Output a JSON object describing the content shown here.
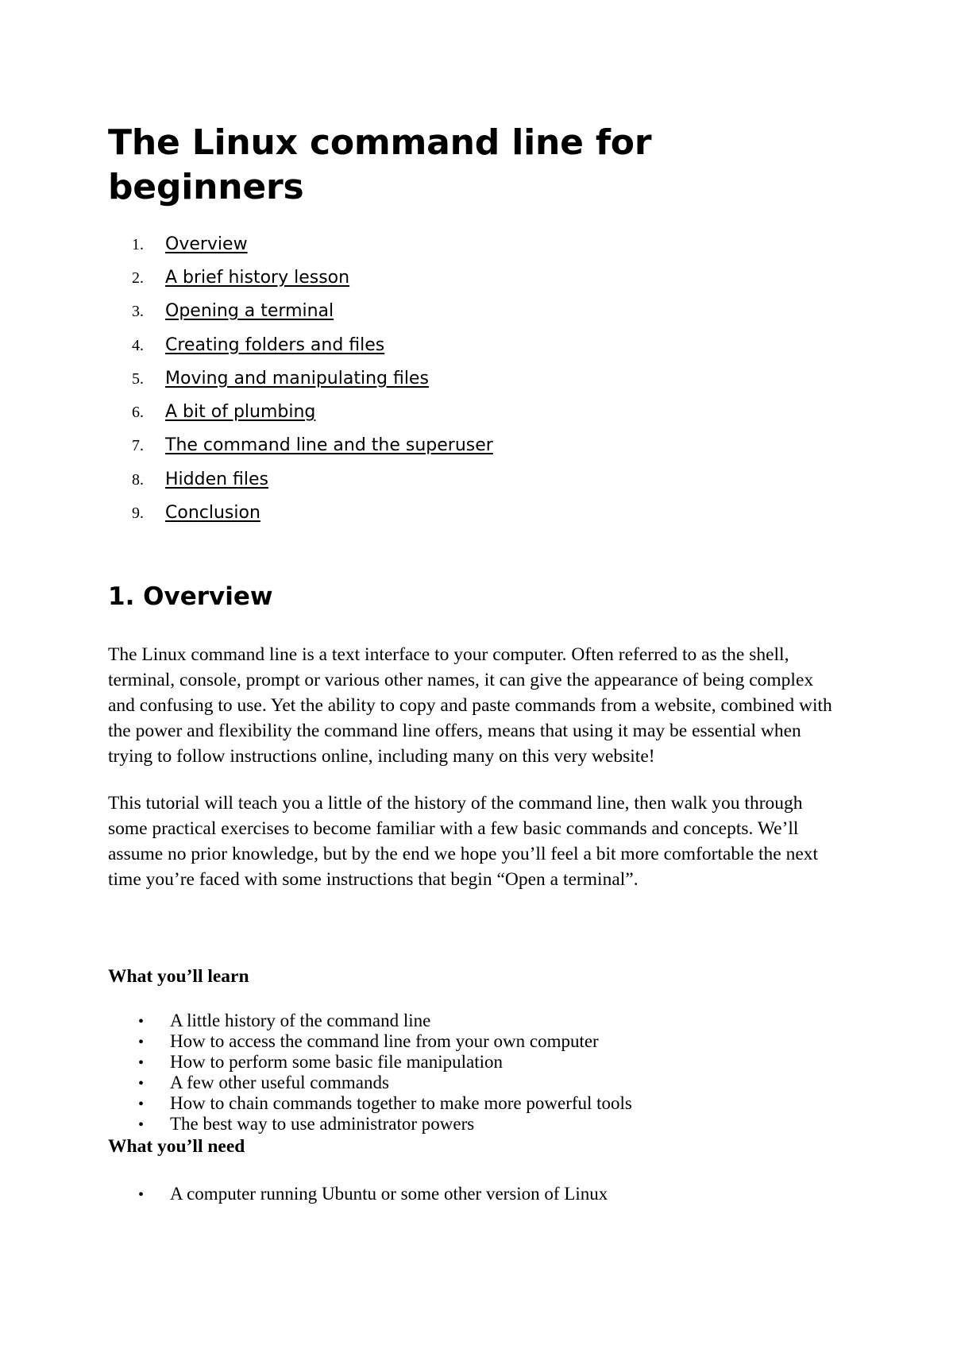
{
  "document": {
    "title": "The Linux command line for beginners",
    "bullet_glyph": "•"
  },
  "toc": {
    "items": [
      {
        "number": "1.",
        "label": "Overview"
      },
      {
        "number": "2.",
        "label": "A brief history lesson"
      },
      {
        "number": "3.",
        "label": "Opening a terminal"
      },
      {
        "number": "4.",
        "label": "Creating folders and files"
      },
      {
        "number": "5.",
        "label": "Moving and manipulating files"
      },
      {
        "number": "6.",
        "label": "A bit of plumbing"
      },
      {
        "number": "7.",
        "label": "The command line and the superuser"
      },
      {
        "number": "8.",
        "label": "Hidden files"
      },
      {
        "number": "9.",
        "label": "Conclusion"
      }
    ]
  },
  "section": {
    "heading": "1. Overview",
    "paragraph_1": "The Linux command line is a text interface to your computer. Often referred to as the shell, terminal, console, prompt or various other names, it can give the appearance of being complex and confusing to use. Yet the ability to copy and paste commands from a website, combined with the power and flexibility the command line offers, means that using it may be essential when trying to follow instructions online, including many on this very website!",
    "paragraph_2": "This tutorial will teach you a little of the history of the command line, then walk you through some practical exercises to become familiar with a few basic commands and concepts. We’ll assume no prior knowledge, but by the end we hope you’ll feel a bit more comfortable the next time you’re faced with some instructions that begin “Open a terminal”."
  },
  "learn": {
    "heading": "What you’ll learn",
    "items": [
      "A little history of the command line",
      "How to access the command line from your own computer",
      "How to perform some basic file manipulation",
      "A few other useful commands",
      "How to chain commands together to make more powerful tools",
      "The best way to use administrator powers"
    ]
  },
  "need": {
    "heading": "What you’ll need",
    "items": [
      "A computer running Ubuntu or some other version of Linux"
    ]
  }
}
